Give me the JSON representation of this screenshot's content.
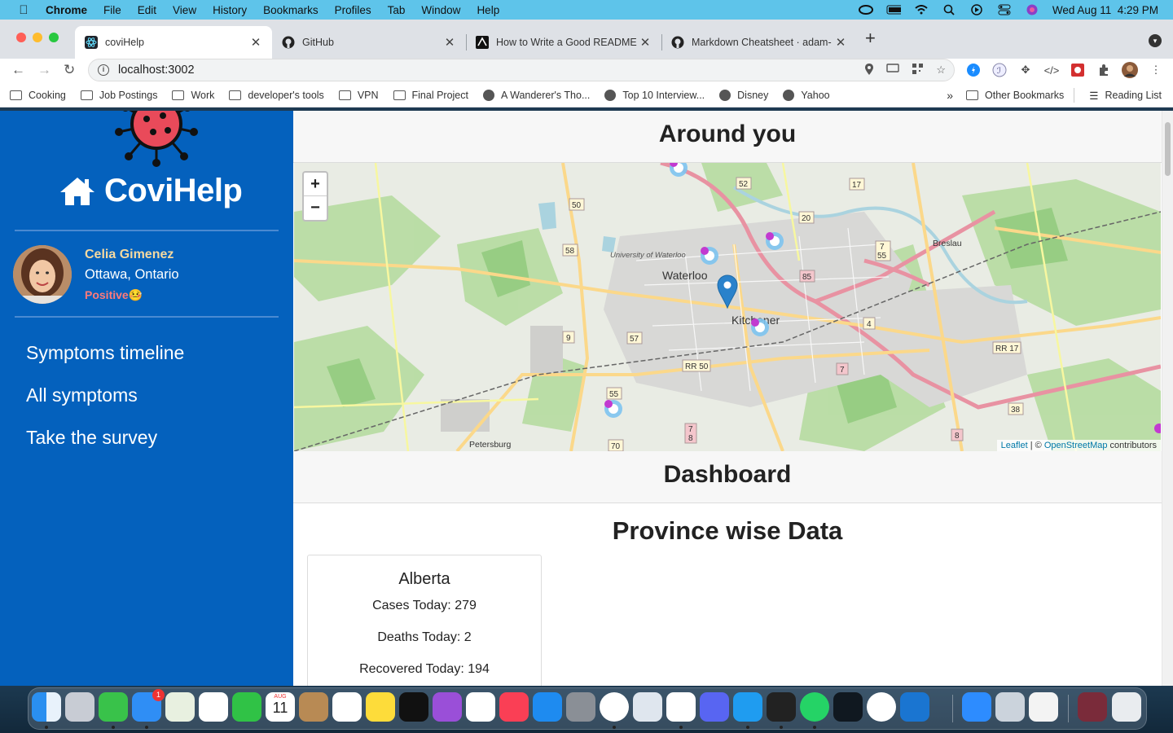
{
  "menubar": {
    "app": "Chrome",
    "items": [
      "File",
      "Edit",
      "View",
      "History",
      "Bookmarks",
      "Profiles",
      "Tab",
      "Window",
      "Help"
    ],
    "clock": "Wed Aug 11  4:29 PM"
  },
  "tabs": [
    {
      "title": "coviHelp",
      "icon": "react-icon",
      "active": true
    },
    {
      "title": "GitHub",
      "icon": "github-icon"
    },
    {
      "title": "How to Write a Good README",
      "icon": "dev-icon"
    },
    {
      "title": "Markdown Cheatsheet · adam-",
      "icon": "github-icon"
    }
  ],
  "address": {
    "url": "localhost:3002"
  },
  "bookmarks": [
    {
      "label": "Cooking",
      "icon": "folder-icon"
    },
    {
      "label": "Job Postings",
      "icon": "folder-icon"
    },
    {
      "label": "Work",
      "icon": "folder-icon"
    },
    {
      "label": "developer's tools",
      "icon": "folder-icon"
    },
    {
      "label": "VPN",
      "icon": "folder-icon"
    },
    {
      "label": "Final Project",
      "icon": "folder-icon"
    },
    {
      "label": "A Wanderer's Tho...",
      "icon": "globe-icon"
    },
    {
      "label": "Top 10 Interview...",
      "icon": "globe-icon"
    },
    {
      "label": "Disney",
      "icon": "globe-icon"
    },
    {
      "label": "Yahoo",
      "icon": "globe-icon"
    }
  ],
  "bookmarks_more": "»",
  "bookmarks_right": {
    "other": "Other Bookmarks",
    "reading": "Reading List"
  },
  "sidebar": {
    "brand": "CoviHelp",
    "user": {
      "name": "Celia Gimenez",
      "location": "Ottawa, Ontario",
      "status": "Positive🤒"
    },
    "nav": [
      "Symptoms timeline",
      "All symptoms",
      "Take the survey"
    ]
  },
  "main": {
    "around_title": "Around you",
    "map": {
      "zoom_in": "+",
      "zoom_out": "−",
      "labels": {
        "waterloo": "Waterloo",
        "kitchener": "Kitchener",
        "breslau": "Breslau",
        "petersburg": "Petersburg",
        "university": "University of Waterloo"
      },
      "roads": [
        "50",
        "52",
        "17",
        "20",
        "58",
        "7",
        "55",
        "85",
        "9",
        "57",
        "4",
        "RR 17",
        "RR 50",
        "7",
        "55",
        "38",
        "8",
        "70",
        "7",
        "8"
      ],
      "attribution": {
        "leaflet": "Leaflet",
        "sep": " | © ",
        "osm": "OpenStreetMap",
        "rest": " contributors"
      }
    },
    "dashboard_title": "Dashboard",
    "province_title": "Province wise Data",
    "card": {
      "name": "Alberta",
      "cases": "Cases Today: 279",
      "deaths": "Deaths Today: 2",
      "recovered": "Recovered Today: 194"
    }
  },
  "dock": {
    "badges": {
      "mail": "1",
      "calendar_month": "AUG",
      "calendar_day": "11"
    }
  }
}
